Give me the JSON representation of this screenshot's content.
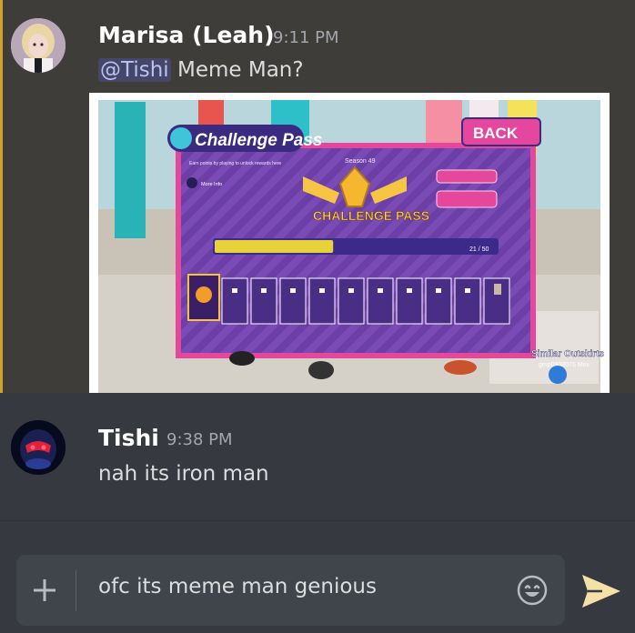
{
  "messages": [
    {
      "author": "Marisa (Leah)",
      "time": "9:11 PM",
      "mention": "@Tishi",
      "text": " Meme Man?",
      "highlight_color": "#d4a12c",
      "attachment": {
        "title_badge": "Challenge Pass",
        "back_label": "BACK",
        "season": "Season 49",
        "info_text": "Earn points by playing to unlock rewards here",
        "more_info": "More Info",
        "logo_text": "CHALLENGE PASS",
        "progress_text": "21 / 50",
        "progress_fraction": 0.42,
        "watermark_line1": "Similar Outskirts",
        "watermark_line2": "gmp0908075 Mini"
      }
    },
    {
      "author": "Tishi",
      "time": "9:38 PM",
      "text": "nah its iron man"
    }
  ],
  "composer": {
    "value": "ofc its meme man genious",
    "plus_icon": "plus-icon",
    "emoji_icon": "smile-emoji-icon",
    "send_icon": "send-arrow-icon"
  },
  "colors": {
    "background": "#36393f",
    "mention_bg": "#3f3d3a",
    "send": "#f4e1a8"
  }
}
